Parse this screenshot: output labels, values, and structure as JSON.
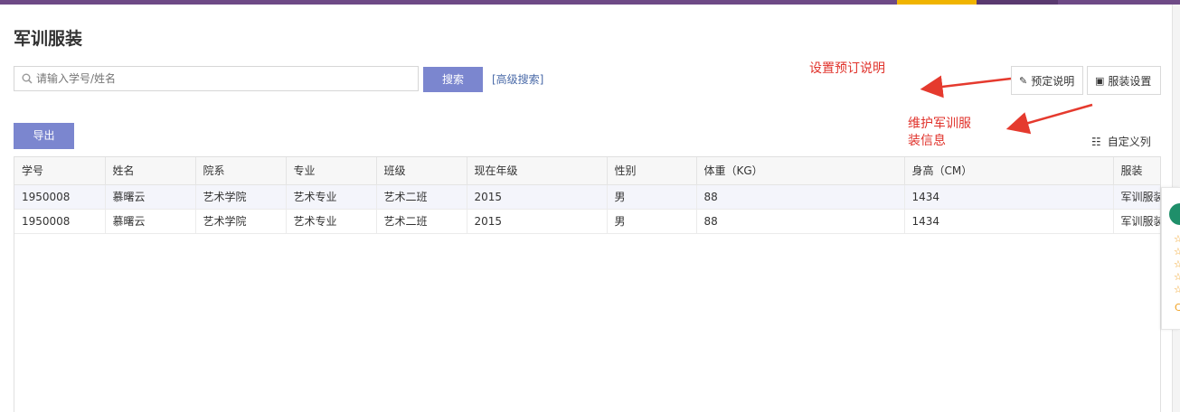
{
  "page": {
    "title": "军训服装"
  },
  "search": {
    "placeholder": "请输入学号/姓名",
    "button_label": "搜索",
    "advanced_label": "[高级搜索]"
  },
  "actions": {
    "booking_desc_label": "预定说明",
    "clothing_settings_label": "服装设置",
    "export_label": "导出",
    "custom_columns_label": "自定义列"
  },
  "annotations": {
    "note1": "设置预订说明",
    "note2": "维护军训服装信息",
    "color": "#e0322b"
  },
  "table": {
    "headers": [
      "学号",
      "姓名",
      "院系",
      "专业",
      "班级",
      "现在年级",
      "性别",
      "体重（KG）",
      "身高（CM）",
      "服装"
    ],
    "rows": [
      [
        "1950008",
        "慕曙云",
        "艺术学院",
        "艺术专业",
        "艺术二班",
        "2015",
        "男",
        "88",
        "1434",
        "军训服装"
      ],
      [
        "1950008",
        "慕曙云",
        "艺术学院",
        "艺术专业",
        "艺术二班",
        "2015",
        "男",
        "88",
        "1434",
        "军训服装"
      ]
    ]
  },
  "colors": {
    "primary": "#7b86cf",
    "topbar": "#6e4a86",
    "topbar_active": "#f0b400",
    "link": "#4a6aa8"
  },
  "icons": {
    "search": "search-icon",
    "edit": "pencil-icon",
    "settings": "chart-icon",
    "columns": "columns-settings-icon"
  }
}
